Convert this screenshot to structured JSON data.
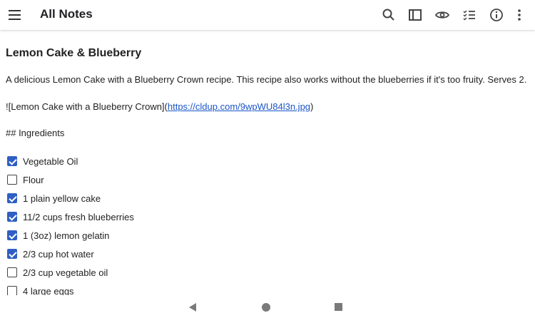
{
  "appbar": {
    "title": "All Notes",
    "icons": [
      "menu-icon",
      "search-icon",
      "sidebar-toggle-icon",
      "preview-eye-icon",
      "checklist-icon",
      "info-icon",
      "more-vert-icon"
    ]
  },
  "note": {
    "title": "Lemon Cake & Blueberry",
    "intro": "A delicious Lemon Cake with a Blueberry Crown recipe. This recipe also works without the blueberries if it's too fruity. Serves 2.",
    "image_prefix": "![Lemon Cake with a Blueberry Crown](",
    "image_url": "https://cldup.com/9wpWU84l3n.jpg",
    "image_suffix": ")",
    "heading": "## Ingredients",
    "checklist": [
      {
        "label": "Vegetable Oil",
        "checked": true
      },
      {
        "label": "Flour",
        "checked": false
      },
      {
        "label": "1 plain yellow cake",
        "checked": true
      },
      {
        "label": "11/2 cups fresh blueberries",
        "checked": true
      },
      {
        "label": "1 (3oz) lemon gelatin",
        "checked": true
      },
      {
        "label": "2/3 cup hot water",
        "checked": true
      },
      {
        "label": "2/3 cup vegetable oil",
        "checked": false
      },
      {
        "label": "4 large eggs",
        "checked": false
      }
    ]
  },
  "colors": {
    "accent": "#2f5fc4",
    "link": "#1a55c8"
  }
}
